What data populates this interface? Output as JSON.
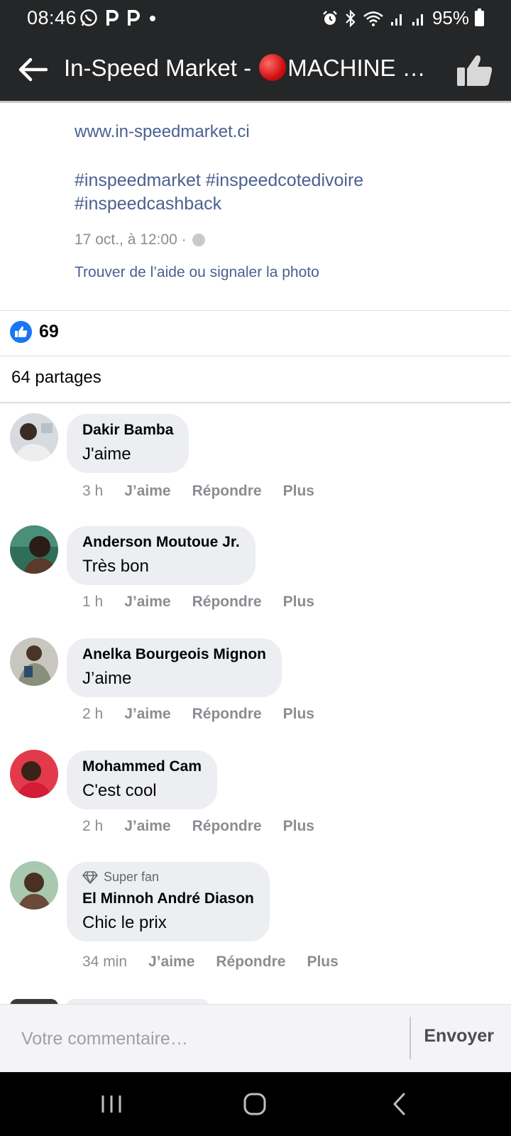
{
  "status_bar": {
    "time": "08:46",
    "battery": "95%",
    "left_icons": [
      "whatsapp-icon",
      "p-icon",
      "p-icon",
      "dot-icon"
    ],
    "right_icons": [
      "alarm-icon",
      "bluetooth-icon",
      "wifi-icon",
      "signal-icon",
      "signal-icon",
      "battery-icon"
    ]
  },
  "app_bar": {
    "title_prefix": "In-Speed Market - ",
    "title_suffix": "MACHINE À ...",
    "back_icon": "arrow-left-icon",
    "like_icon": "thumbs-up-icon"
  },
  "post": {
    "link": "www.in-speedmarket.ci",
    "hashtags": "#inspeedmarket #inspeedcotedivoire #inspeedcashback",
    "date": "17 oct., à 12:00 ·",
    "help_link": "Trouver de l’aide ou signaler la photo"
  },
  "reactions": {
    "count": "69",
    "shares": "64 partages"
  },
  "comments": [
    {
      "author": "Dakir Bamba",
      "text": "J'aime",
      "time": "3 h",
      "like": "J’aime",
      "reply": "Répondre",
      "more": "Plus"
    },
    {
      "author": "Anderson Moutoue Jr.",
      "text": "Très bon",
      "time": "1 h",
      "like": "J’aime",
      "reply": "Répondre",
      "more": "Plus"
    },
    {
      "author": "Anelka Bourgeois Mignon",
      "text": "J’aime",
      "time": "2 h",
      "like": "J’aime",
      "reply": "Répondre",
      "more": "Plus"
    },
    {
      "author": "Mohammed Cam",
      "text": "C'est cool",
      "time": "2 h",
      "like": "J’aime",
      "reply": "Répondre",
      "more": "Plus"
    },
    {
      "badge": "Super fan",
      "author": "El Minnoh André Diason",
      "text": "Chic le prix",
      "time": "34 min",
      "like": "J’aime",
      "reply": "Répondre",
      "more": "Plus"
    }
  ],
  "composer": {
    "placeholder": "Votre commentaire…",
    "send": "Envoyer"
  },
  "colors": {
    "bar": "#252627",
    "link": "#4b6190",
    "bubble": "#eceef1",
    "like_blue": "#1877f2"
  }
}
